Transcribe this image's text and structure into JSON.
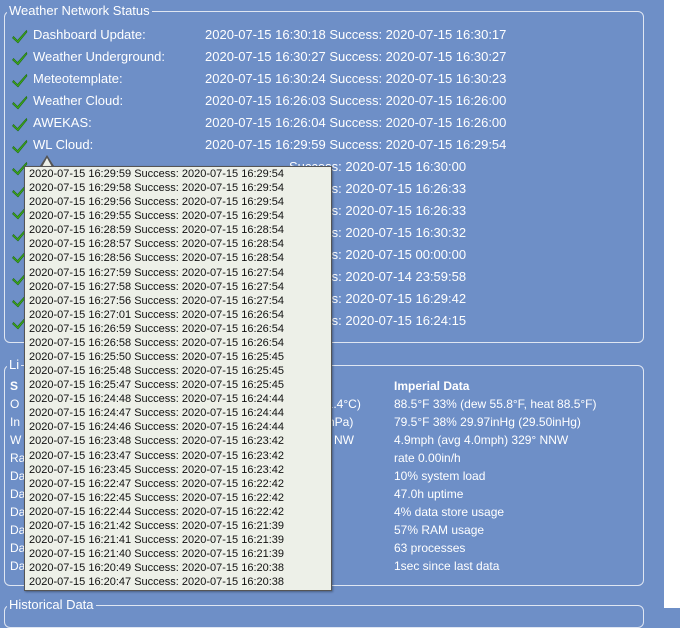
{
  "network": {
    "legend": "Weather Network Status",
    "rows": [
      {
        "service": "Dashboard Update:",
        "status": "2020-07-15 16:30:18 Success: 2020-07-15 16:30:17"
      },
      {
        "service": "Weather Underground:",
        "status": "2020-07-15 16:30:27 Success: 2020-07-15 16:30:27"
      },
      {
        "service": "Meteotemplate:",
        "status": "2020-07-15 16:30:24 Success: 2020-07-15 16:30:23"
      },
      {
        "service": "Weather Cloud:",
        "status": "2020-07-15 16:26:03 Success: 2020-07-15 16:26:00"
      },
      {
        "service": "AWEKAS:",
        "status": "2020-07-15 16:26:04 Success: 2020-07-15 16:26:00"
      },
      {
        "service": "WL Cloud:",
        "status": "2020-07-15 16:29:59 Success: 2020-07-15 16:29:54"
      },
      {
        "service": "",
        "status": "Success: 2020-07-15 16:30:00"
      },
      {
        "service": "",
        "status": "Success: 2020-07-15 16:26:33"
      },
      {
        "service": "",
        "status": "Success: 2020-07-15 16:26:33"
      },
      {
        "service": "",
        "status": "Success: 2020-07-15 16:30:32"
      },
      {
        "service": "",
        "status": "Success: 2020-07-15 00:00:00"
      },
      {
        "service": "",
        "status": "Success: 2020-07-14 23:59:58"
      },
      {
        "service": "",
        "status": "Success: 2020-07-15 16:29:42"
      },
      {
        "service": "",
        "status": "Success: 2020-07-15 16:24:15"
      }
    ]
  },
  "live": {
    "legend": "Li",
    "col_left_header": "S",
    "left_rows": [
      "O",
      "In",
      "W",
      "Ra",
      "Da",
      "Da",
      "Da",
      "Da",
      "Da",
      "Da"
    ],
    "mid_rows": [
      "31.4°C)",
      "hPa)",
      "NW"
    ],
    "imperial_header": "Imperial Data",
    "imperial_rows": [
      "88.5°F 33% (dew 55.8°F, heat 88.5°F)",
      "79.5°F 38% 29.97inHg (29.50inHg)",
      "4.9mph (avg 4.0mph) 329° NNW",
      "rate 0.00in/h",
      "10% system load",
      "47.0h uptime",
      "4% data store usage",
      "57% RAM usage",
      "63 processes",
      "1sec since last data"
    ]
  },
  "historical": {
    "legend": "Historical Data"
  },
  "popup": {
    "lines": [
      "2020-07-15 16:29:59 Success: 2020-07-15 16:29:54",
      "2020-07-15 16:29:58 Success: 2020-07-15 16:29:54",
      "2020-07-15 16:29:56 Success: 2020-07-15 16:29:54",
      "2020-07-15 16:29:55 Success: 2020-07-15 16:29:54",
      "2020-07-15 16:28:59 Success: 2020-07-15 16:28:54",
      "2020-07-15 16:28:57 Success: 2020-07-15 16:28:54",
      "2020-07-15 16:28:56 Success: 2020-07-15 16:28:54",
      "2020-07-15 16:27:59 Success: 2020-07-15 16:27:54",
      "2020-07-15 16:27:58 Success: 2020-07-15 16:27:54",
      "2020-07-15 16:27:56 Success: 2020-07-15 16:27:54",
      "2020-07-15 16:27:01 Success: 2020-07-15 16:26:54",
      "2020-07-15 16:26:59 Success: 2020-07-15 16:26:54",
      "2020-07-15 16:26:58 Success: 2020-07-15 16:26:54",
      "2020-07-15 16:25:50 Success: 2020-07-15 16:25:45",
      "2020-07-15 16:25:48 Success: 2020-07-15 16:25:45",
      "2020-07-15 16:25:47 Success: 2020-07-15 16:25:45",
      "2020-07-15 16:24:48 Success: 2020-07-15 16:24:44",
      "2020-07-15 16:24:47 Success: 2020-07-15 16:24:44",
      "2020-07-15 16:24:46 Success: 2020-07-15 16:24:44",
      "2020-07-15 16:23:48 Success: 2020-07-15 16:23:42",
      "2020-07-15 16:23:47 Success: 2020-07-15 16:23:42",
      "2020-07-15 16:23:45 Success: 2020-07-15 16:23:42",
      "2020-07-15 16:22:47 Success: 2020-07-15 16:22:42",
      "2020-07-15 16:22:45 Success: 2020-07-15 16:22:42",
      "2020-07-15 16:22:44 Success: 2020-07-15 16:22:42",
      "2020-07-15 16:21:42 Success: 2020-07-15 16:21:39",
      "2020-07-15 16:21:41 Success: 2020-07-15 16:21:39",
      "2020-07-15 16:21:40 Success: 2020-07-15 16:21:39",
      "2020-07-15 16:20:49 Success: 2020-07-15 16:20:38",
      "2020-07-15 16:20:47 Success: 2020-07-15 16:20:38"
    ]
  },
  "colors": {
    "background": "#6e8fc7",
    "check": "#3faa1f",
    "popup_bg": "#edf0e8"
  }
}
